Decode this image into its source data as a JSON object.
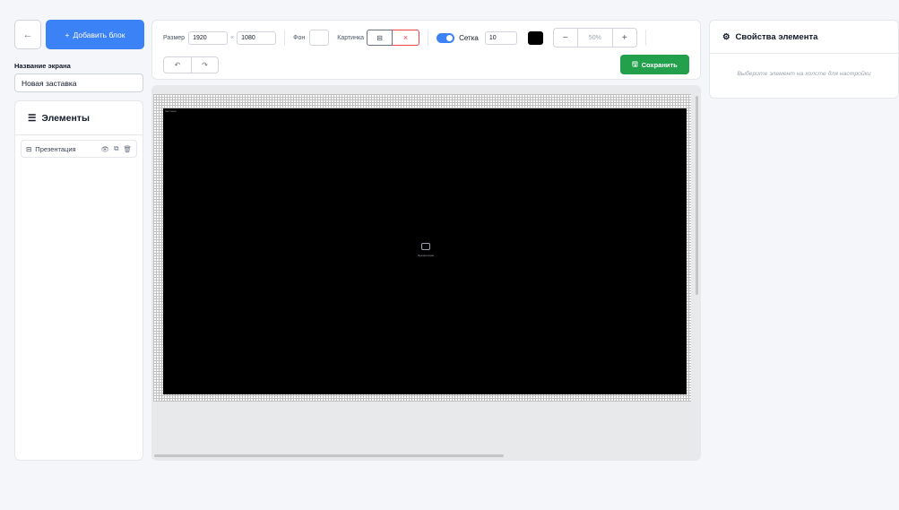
{
  "left": {
    "back_icon": "arrow-left-icon",
    "back_glyph": "←",
    "add_block": {
      "icon": "+",
      "label": "Добавить блок"
    },
    "screen_name_label": "Название экрана",
    "screen_name_value": "Новая заставка",
    "elements": {
      "title_icon": "☰",
      "title": "Элементы",
      "items": [
        {
          "icon": "⊟",
          "label": "Презентация",
          "actions": [
            "👁",
            "⧉",
            "🗑"
          ]
        }
      ]
    }
  },
  "toolbar": {
    "size_label": "Размер",
    "width": "1920",
    "times": "×",
    "height": "1080",
    "bg_label": "Фон",
    "image_label": "Картинка",
    "image_icon": "⊟",
    "image_clear": "×",
    "grid_label": "Сетка",
    "grid_enabled": true,
    "grid_size": "10",
    "grid_color": "#000000",
    "zoom_minus": "−",
    "zoom_value": "50%",
    "zoom_plus": "+",
    "undo": "↶",
    "redo": "↷",
    "save": {
      "icon": "🖫",
      "label": "Сохранить"
    }
  },
  "canvas": {
    "screen_background": "#000000",
    "corner_label": "Заставка",
    "element_label": "Презентация"
  },
  "properties": {
    "title_icon": "⚙",
    "title": "Свойства элемента",
    "hint": "Выберите элемент на холсте для настройки"
  },
  "colors": {
    "accent": "#3b82f6",
    "save": "#22a04b",
    "danger": "#ef4444"
  }
}
